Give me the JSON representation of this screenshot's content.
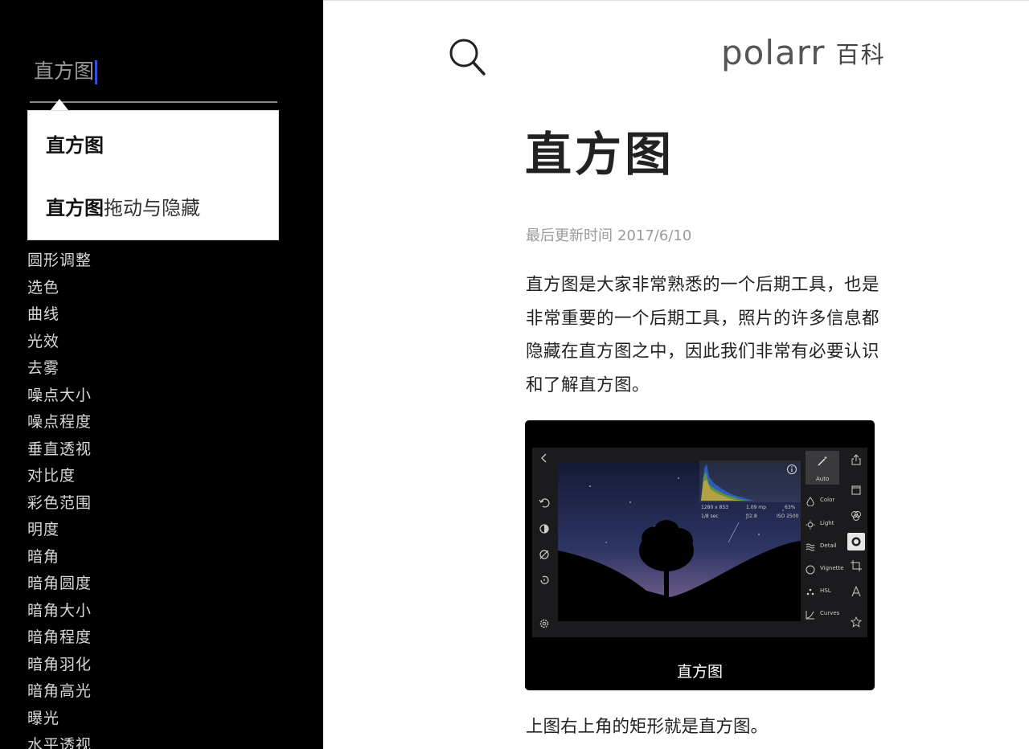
{
  "sidebar": {
    "search_value": "直方图",
    "suggestions": [
      {
        "match": "直方图",
        "rest": ""
      },
      {
        "match": "直方图",
        "rest": "拖动与隐藏"
      }
    ],
    "nav_items": [
      "圆形调整",
      "选色",
      "曲线",
      "光效",
      "去雾",
      "噪点大小",
      "噪点程度",
      "垂直透视",
      "对比度",
      "彩色范围",
      "明度",
      "暗角",
      "暗角圆度",
      "暗角大小",
      "暗角程度",
      "暗角羽化",
      "暗角高光",
      "曝光",
      "水平透视"
    ]
  },
  "header": {
    "brand_name": "polarr",
    "brand_suffix": "百科"
  },
  "article": {
    "title": "直方图",
    "updated_label": "最后更新时间",
    "updated_date": "2017/6/10",
    "intro": "直方图是大家非常熟悉的一个后期工具，也是非常重要的一个后期工具，照片的许多信息都隐藏在直方图之中，因此我们非常有必要认识和了解直方图。",
    "figure_caption": "直方图",
    "outro": "上图右上角的矩形就是直方图。"
  },
  "screenshot_ui": {
    "auto_label": "Auto",
    "tools": [
      "Color",
      "Light",
      "Detail",
      "Vignette",
      "HSL",
      "Curves"
    ],
    "histogram_stats": {
      "resolution": "1280 x 853",
      "megapixels": "1.09 mp",
      "percent": "63%",
      "shutter": "1/8 sec",
      "aperture": "ƒ/2.8",
      "iso": "ISO 2500"
    }
  },
  "colors": {
    "sidebar_bg": "#000000",
    "caret": "#3a4fd8",
    "nav_text": "#d8d8d8"
  }
}
